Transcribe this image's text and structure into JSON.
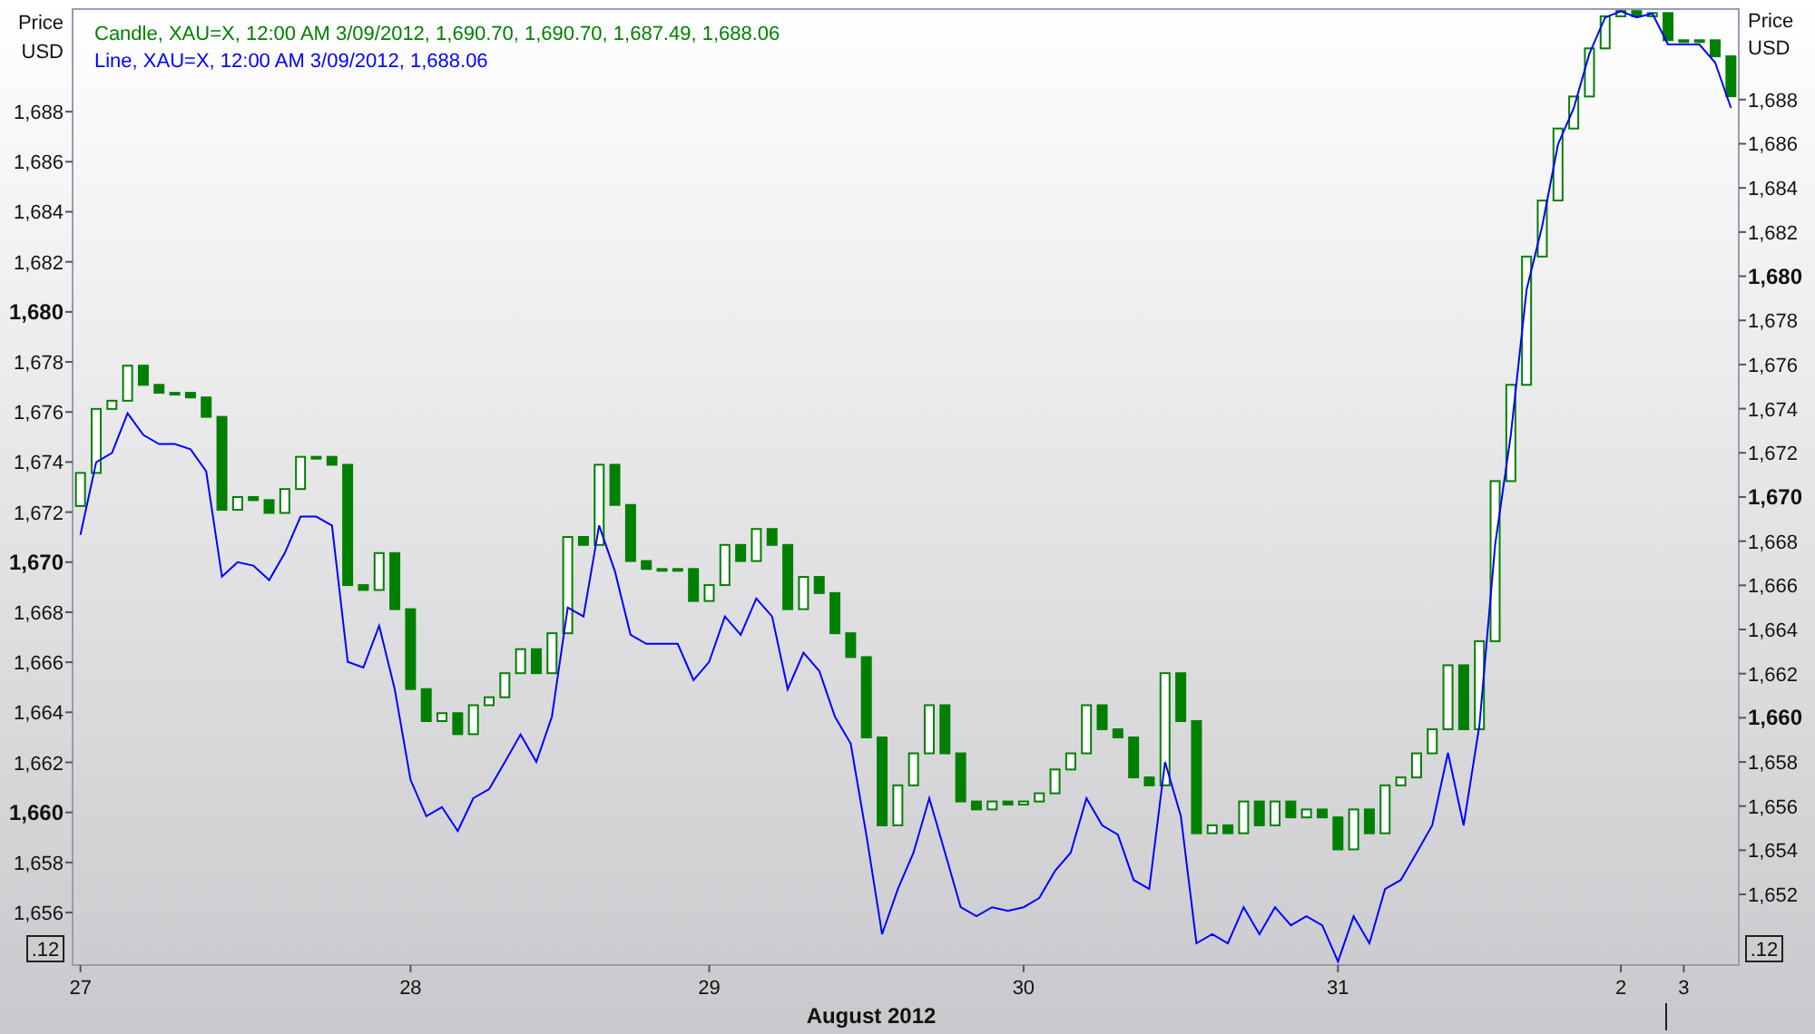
{
  "legend": [
    {
      "name": "Candle",
      "color": "#008000",
      "detail": ", XAU=X, 12:00 AM 3/09/2012, 1,690.70, 1,690.70, 1,687.49, 1,688.06"
    },
    {
      "detail": ", XAU=X, 12:00 AM 3/09/2012, 1,688.06"
    }
  ],
  "left_axis": {
    "title_lines": [
      "Price",
      "USD"
    ],
    "badge": ".12"
  },
  "right_axis": {
    "title_lines": [
      "Price",
      "USD"
    ],
    "badge": ".12"
  },
  "chart_data": {
    "type": "line",
    "xlabel": "August 2012",
    "categories": [
      "27",
      null,
      null,
      null,
      null,
      null,
      null,
      null,
      null,
      null,
      null,
      null,
      null,
      null,
      null,
      null,
      null,
      null,
      null,
      null,
      null,
      "28",
      null,
      null,
      null,
      null,
      null,
      null,
      null,
      null,
      null,
      null,
      null,
      null,
      null,
      null,
      null,
      null,
      null,
      null,
      "29",
      null,
      null,
      null,
      null,
      null,
      null,
      null,
      null,
      null,
      null,
      null,
      null,
      null,
      null,
      null,
      null,
      null,
      null,
      null,
      "30",
      null,
      null,
      null,
      null,
      null,
      null,
      null,
      null,
      null,
      null,
      null,
      null,
      null,
      null,
      null,
      null,
      null,
      null,
      null,
      "31",
      null,
      null,
      null,
      null,
      null,
      null,
      null,
      null,
      null,
      null,
      null,
      null,
      null,
      null,
      null,
      null,
      null,
      "2",
      null,
      null,
      null,
      "3",
      null,
      null,
      null
    ],
    "ylim": [
      1653.9,
      1692.1
    ],
    "yticks": [
      {
        "value": 1688,
        "label": "1,688"
      },
      {
        "value": 1686,
        "label": "1,686"
      },
      {
        "value": 1684,
        "label": "1,684"
      },
      {
        "value": 1682,
        "label": "1,682"
      },
      {
        "value": 1680,
        "label": "1,680"
      },
      {
        "value": 1678,
        "label": "1,678"
      },
      {
        "value": 1676,
        "label": "1,676"
      },
      {
        "value": 1674,
        "label": "1,674"
      },
      {
        "value": 1672,
        "label": "1,672"
      },
      {
        "value": 1670,
        "label": "1,670"
      },
      {
        "value": 1668,
        "label": "1,668"
      },
      {
        "value": 1666,
        "label": "1,666"
      },
      {
        "value": 1664,
        "label": "1,664"
      },
      {
        "value": 1662,
        "label": "1,662"
      },
      {
        "value": 1660,
        "label": "1,660"
      },
      {
        "value": 1658,
        "label": "1,658"
      },
      {
        "value": 1656,
        "label": "1,656"
      }
    ],
    "y2lim": [
      1648.8,
      1692.1
    ],
    "y2ticks": [
      {
        "value": 1688,
        "label": "1,688"
      },
      {
        "value": 1686,
        "label": "1,686"
      },
      {
        "value": 1684,
        "label": "1,684"
      },
      {
        "value": 1682,
        "label": "1,682"
      },
      {
        "value": 1680,
        "label": "1,680"
      },
      {
        "value": 1678,
        "label": "1,678"
      },
      {
        "value": 1676,
        "label": "1,676"
      },
      {
        "value": 1674,
        "label": "1,674"
      },
      {
        "value": 1672,
        "label": "1,672"
      },
      {
        "value": 1670,
        "label": "1,670"
      },
      {
        "value": 1668,
        "label": "1,668"
      },
      {
        "value": 1666,
        "label": "1,666"
      },
      {
        "value": 1664,
        "label": "1,664"
      },
      {
        "value": 1662,
        "label": "1,662"
      },
      {
        "value": 1660,
        "label": "1,660"
      },
      {
        "value": 1658,
        "label": "1,658"
      },
      {
        "value": 1656,
        "label": "1,656"
      },
      {
        "value": 1654,
        "label": "1,654"
      },
      {
        "value": 1652,
        "label": "1,652"
      }
    ],
    "series": [
      {
        "name": "Line",
        "color": "#0000ff",
        "values": [
          1671.09,
          1673.99,
          1674.36,
          1675.95,
          1675.08,
          1674.72,
          1674.72,
          1674.51,
          1673.63,
          1669.42,
          1670.0,
          1669.86,
          1669.28,
          1670.36,
          1671.82,
          1671.82,
          1671.46,
          1666.01,
          1665.79,
          1667.46,
          1664.92,
          1661.3,
          1659.85,
          1660.21,
          1659.26,
          1660.57,
          1660.93,
          1662.02,
          1663.11,
          1662.02,
          1663.83,
          1668.19,
          1667.83,
          1671.46,
          1669.64,
          1667.1,
          1666.74,
          1666.74,
          1666.74,
          1665.29,
          1666.01,
          1667.83,
          1667.1,
          1668.55,
          1667.83,
          1664.92,
          1666.38,
          1665.65,
          1663.83,
          1662.75,
          1659.11,
          1655.13,
          1656.94,
          1658.39,
          1660.57,
          1658.39,
          1656.21,
          1655.85,
          1656.21,
          1656.07,
          1656.21,
          1656.58,
          1657.66,
          1658.39,
          1660.57,
          1659.48,
          1659.11,
          1657.3,
          1656.94,
          1662.02,
          1659.85,
          1654.77,
          1655.13,
          1654.77,
          1656.21,
          1655.13,
          1656.21,
          1655.49,
          1655.85,
          1655.49,
          1654.04,
          1655.85,
          1654.77,
          1656.94,
          1657.3,
          1658.39,
          1659.48,
          1662.38,
          1659.48,
          1663.47,
          1670.72,
          1675.08,
          1680.89,
          1683.43,
          1686.69,
          1688.14,
          1690.32,
          1691.77,
          1692.01,
          1691.77,
          1691.92,
          1690.69,
          1690.69,
          1690.69,
          1689.96,
          1688.15
        ]
      }
    ]
  }
}
